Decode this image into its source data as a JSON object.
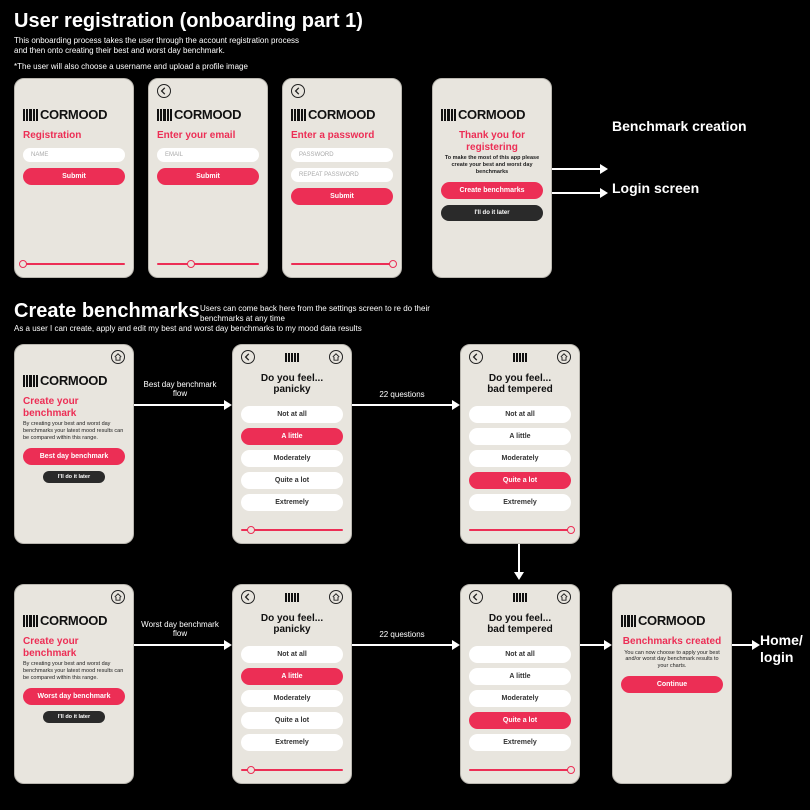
{
  "brand": "CORMOOD",
  "sections": {
    "reg_title": "User registration (onboarding part 1)",
    "bench_title": "Create benchmarks",
    "note1": "This onboarding process takes the user through the account registration process and then onto creating their best and worst day benchmark.",
    "note2": "*The user will also choose a username and upload a profile image",
    "bench_note": "Users can come back here from the settings screen to re do their benchmarks at any time",
    "bench_sub": "As a user I can create, apply and edit my best and worst day benchmarks to my mood data results",
    "best_flow": "Best day benchmark flow",
    "worst_flow": "Worst day benchmark flow",
    "q_range": "22 questions",
    "benchmark_creation": "Benchmark creation",
    "login_screen": "Login screen",
    "home_login": "Home/\nlogin"
  },
  "screens": {
    "reg": {
      "title": "Registration",
      "name_ph": "NAME",
      "submit": "Submit"
    },
    "email": {
      "title": "Enter your email",
      "email_ph": "EMAIL",
      "submit": "Submit"
    },
    "pass": {
      "title": "Enter a password",
      "p1": "PASSWORD",
      "p2": "REPEAT PASSWORD",
      "submit": "Submit"
    },
    "thanks": {
      "title": "Thank you for registering",
      "desc": "To make the most of this app please create your best and worst day benchmarks",
      "create": "Create benchmarks",
      "later": "I'll do it later"
    },
    "create_best": {
      "title": "Create your benchmark",
      "desc": "By creating your best and worst day benchmarks your latest mood results can be compared within this range.",
      "btn": "Best day benchmark",
      "later": "I'll do it later"
    },
    "create_worst": {
      "title": "Create your benchmark",
      "desc": "By creating your best and worst day benchmarks your latest mood results can be compared within this range.",
      "btn": "Worst day benchmark",
      "later": "I'll do it later"
    },
    "q": {
      "lead": "Do you feel...",
      "panicky": "panicky",
      "bad_tempered": "bad tempered",
      "o1": "Not at all",
      "o2": "A little",
      "o3": "Moderately",
      "o4": "Quite a lot",
      "o5": "Extremely"
    },
    "done": {
      "title": "Benchmarks created",
      "desc": "You can now choose to apply your best and/or worst day benchmark results to your charts.",
      "btn": "Continue"
    }
  }
}
